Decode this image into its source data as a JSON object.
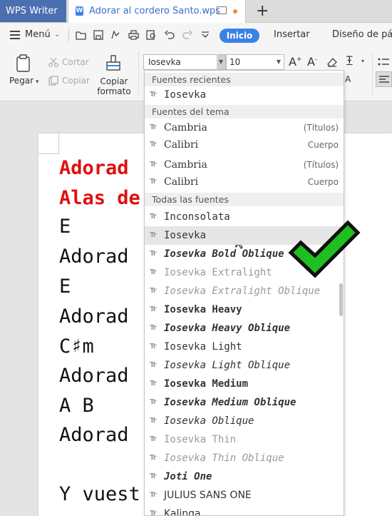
{
  "tabs": {
    "app_label": "WPS Writer",
    "doc_icon_glyph": "W",
    "doc_title": "Adorar al cordero Santo.wps",
    "new_tab": "+"
  },
  "menubar": {
    "menu_label": "Menú",
    "inicio": "Inicio",
    "insertar": "Insertar",
    "diseno": "Diseño de pág"
  },
  "ribbon": {
    "paste": "Pegar",
    "cut": "Cortar",
    "copy": "Copiar",
    "copy_format": "Copiar\nformato",
    "font_value": "Iosevka",
    "size_value": "10"
  },
  "document": {
    "lines": [
      {
        "text": "Adorad ",
        "style": "red"
      },
      {
        "text": "Alas de",
        "style": "red"
      },
      {
        "text": "E",
        "style": "normal"
      },
      {
        "text": "Adorad ",
        "style": "normal"
      },
      {
        "text": "E",
        "style": "normal"
      },
      {
        "text": "Adorad ",
        "style": "normal"
      },
      {
        "text": "C♯m",
        "style": "normal"
      },
      {
        "text": "Adorad ",
        "style": "normal"
      },
      {
        "text": "A   B",
        "style": "normal"
      },
      {
        "text": "Adorad ",
        "style": "normal"
      },
      {
        "text": "",
        "style": "normal"
      },
      {
        "text": "Y vuest",
        "style": "normal"
      }
    ]
  },
  "font_dropdown": {
    "sections": {
      "recent": "Fuentes recientes",
      "theme": "Fuentes del tema",
      "all": "Todas las fuentes"
    },
    "recent": [
      {
        "name": "Iosevka"
      }
    ],
    "theme": [
      {
        "name": "Cambria",
        "role": "(Títulos)"
      },
      {
        "name": "Calibri",
        "role": "Cuerpo"
      },
      {
        "name": "Cambria",
        "role": "(Títulos)"
      },
      {
        "name": "Calibri",
        "role": "Cuerpo"
      }
    ],
    "all": [
      {
        "name": "Inconsolata",
        "weight": "normal",
        "italic": false,
        "light": false
      },
      {
        "name": "Iosevka",
        "weight": "normal",
        "italic": false,
        "light": false,
        "highlighted": true
      },
      {
        "name": "Iosevka Bold Oblique",
        "weight": "bold",
        "italic": true,
        "light": false
      },
      {
        "name": "Iosevka Extralight",
        "weight": "normal",
        "italic": false,
        "light": true
      },
      {
        "name": "Iosevka Extralight Oblique",
        "weight": "normal",
        "italic": true,
        "light": true
      },
      {
        "name": "Iosevka Heavy",
        "weight": "bold",
        "italic": false,
        "light": false
      },
      {
        "name": "Iosevka Heavy Oblique",
        "weight": "bold",
        "italic": true,
        "light": false
      },
      {
        "name": "Iosevka Light",
        "weight": "normal",
        "italic": false,
        "light": false
      },
      {
        "name": "Iosevka Light Oblique",
        "weight": "normal",
        "italic": true,
        "light": false
      },
      {
        "name": "Iosevka Medium",
        "weight": "bold",
        "italic": false,
        "light": false
      },
      {
        "name": "Iosevka Medium Oblique",
        "weight": "bold",
        "italic": true,
        "light": false
      },
      {
        "name": "Iosevka Oblique",
        "weight": "normal",
        "italic": true,
        "light": false
      },
      {
        "name": "Iosevka Thin",
        "weight": "normal",
        "italic": false,
        "light": true
      },
      {
        "name": "Iosevka Thin Oblique",
        "weight": "normal",
        "italic": true,
        "light": true
      },
      {
        "name": "Joti One",
        "weight": "bold",
        "italic": true,
        "light": false
      },
      {
        "name": "JULIUS SANS ONE",
        "weight": "normal",
        "italic": false,
        "light": false
      },
      {
        "name": "Kalinga",
        "weight": "normal",
        "italic": false,
        "light": false
      }
    ]
  },
  "colors": {
    "accent": "#3b82e6",
    "doc_red": "#e01010",
    "check_green": "#1fbf1f"
  },
  "icons": [
    "hamburger-icon",
    "open-icon",
    "save-icon",
    "print-icon",
    "undo-icon",
    "redo-icon",
    "paste-icon",
    "scissors-icon",
    "copy-icon",
    "brush-icon",
    "font-icon",
    "checkmark-icon"
  ]
}
